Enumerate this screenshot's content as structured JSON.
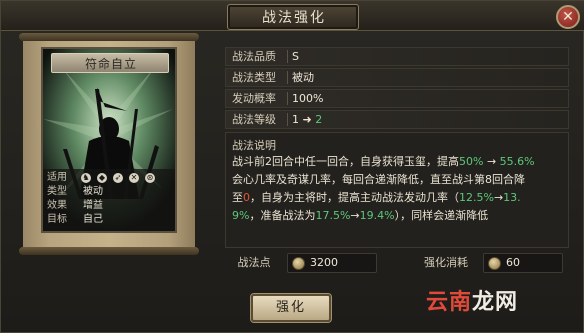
{
  "window": {
    "title": "战法强化",
    "close_icon": "close-icon"
  },
  "card": {
    "name": "符命自立",
    "stats": [
      {
        "key": "适用",
        "value": ""
      },
      {
        "key": "类型",
        "value": "被动"
      },
      {
        "key": "效果",
        "value": "增益"
      },
      {
        "key": "目标",
        "value": "自己"
      }
    ],
    "unit_icons": [
      "cavalry-icon",
      "shield-icon",
      "archer-icon",
      "spear-icon",
      "siege-icon"
    ]
  },
  "info": [
    {
      "key": "战法品质",
      "value": "S"
    },
    {
      "key": "战法类型",
      "value": "被动"
    },
    {
      "key": "发动概率",
      "value": "100%"
    },
    {
      "key": "战法等级",
      "from": "1",
      "arrow": "➜",
      "to": "2"
    }
  ],
  "description": {
    "heading": "战法说明",
    "lines": [
      [
        {
          "t": "战斗前2回合中任一回合，自身获得玉玺，提高"
        },
        {
          "t": "50%",
          "c": "g"
        },
        {
          "t": " → "
        },
        {
          "t": "55.6%",
          "c": "g"
        }
      ],
      [
        {
          "t": "会心几率及奇谋几率，每回合递渐降低，直至战斗第8回合降"
        }
      ],
      [
        {
          "t": "至"
        },
        {
          "t": "0",
          "c": "r"
        },
        {
          "t": "，自身为主将时，提高主动战法发动几率（"
        },
        {
          "t": "12.5%",
          "c": "g"
        },
        {
          "t": "→"
        },
        {
          "t": "13.",
          "c": "g"
        }
      ],
      [
        {
          "t": "9%",
          "c": "g"
        },
        {
          "t": "，准备战法为"
        },
        {
          "t": "17.5%",
          "c": "g"
        },
        {
          "t": "→"
        },
        {
          "t": "19.4%",
          "c": "g"
        },
        {
          "t": "），同样会递渐降低"
        }
      ]
    ]
  },
  "bottom": {
    "points_label": "战法点",
    "points_value": "3200",
    "cost_label": "强化消耗",
    "cost_value": "60"
  },
  "button": {
    "label": "强化"
  },
  "watermark": {
    "part1": "云南",
    "part2": "龙网"
  },
  "colors": {
    "highlight_green": "#5cc77a",
    "highlight_red": "#e0533c",
    "close_red": "#a83428"
  }
}
